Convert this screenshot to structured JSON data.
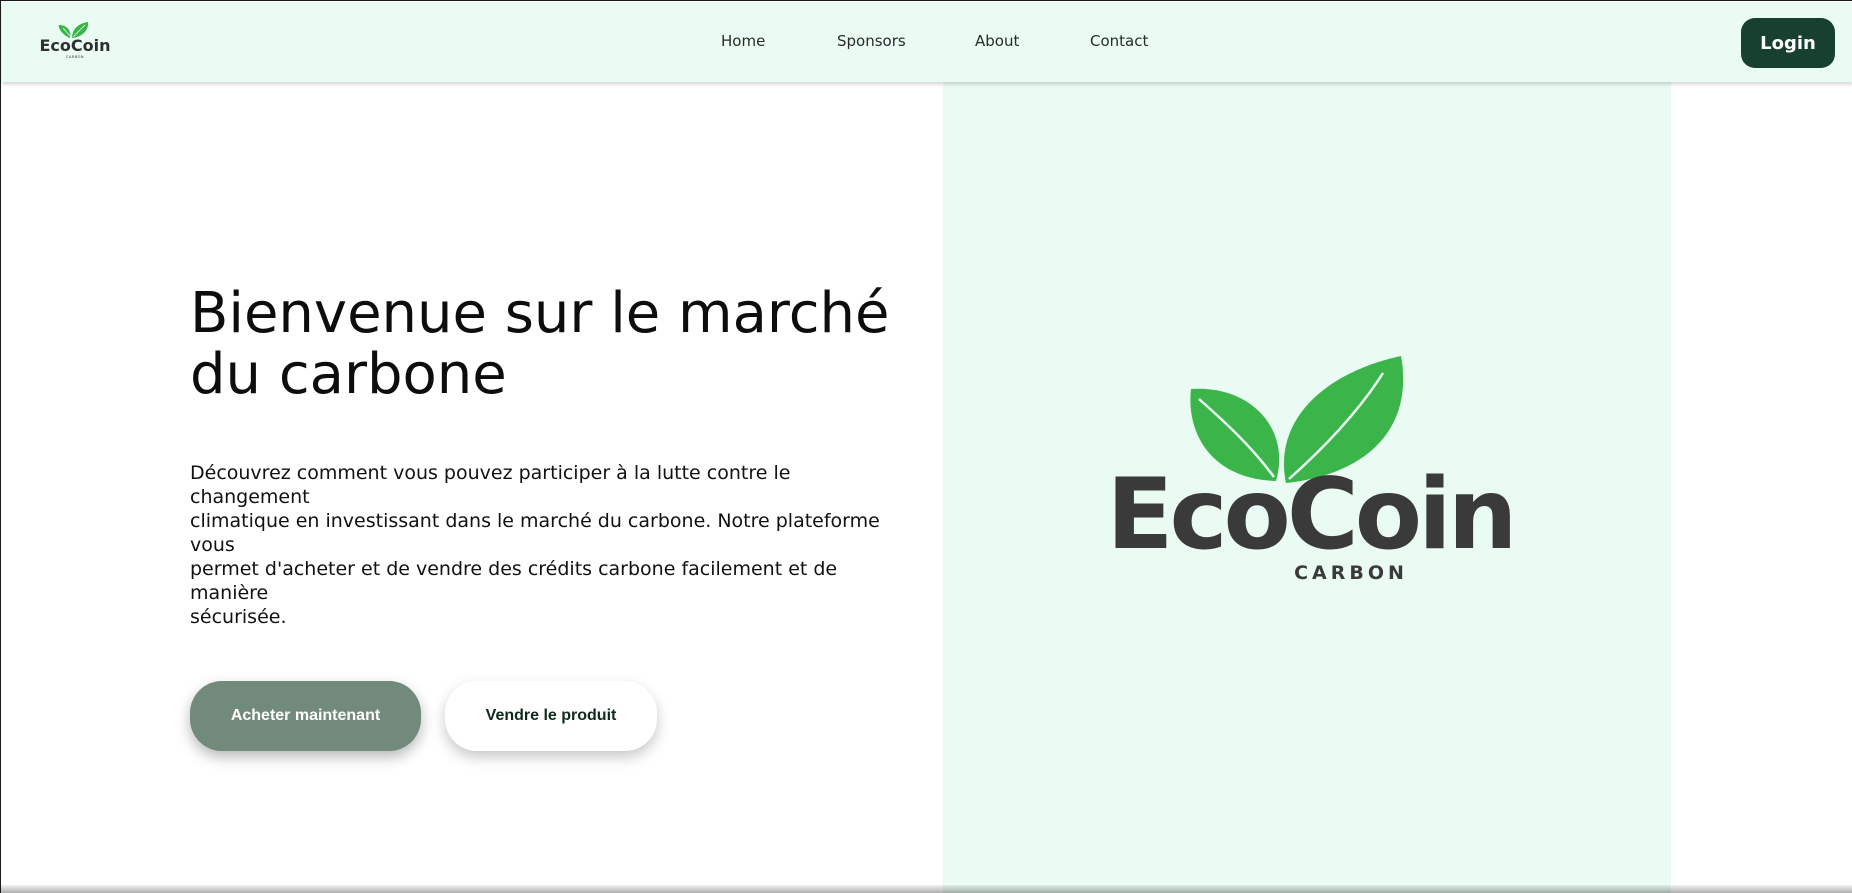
{
  "header": {
    "logo_text": "EcoCoin",
    "logo_subtext": "CARBON",
    "nav": [
      {
        "label": "Home"
      },
      {
        "label": "Sponsors"
      },
      {
        "label": "About"
      },
      {
        "label": "Contact"
      }
    ],
    "login_label": "Login"
  },
  "hero": {
    "title_line1": "Bienvenue sur le marché",
    "title_line2": "du carbone",
    "desc_line1": "Découvrez comment vous pouvez participer à la lutte contre le changement",
    "desc_line2": "climatique en investissant dans le marché du carbone. Notre plateforme vous",
    "desc_line3": "permet d'acheter et de vendre des crédits carbone facilement et de manière",
    "desc_line4": "sécurisée.",
    "buy_label": "Acheter maintenant",
    "sell_label": "Vendre le produit"
  },
  "brand": {
    "name": "EcoCoin",
    "sub": "CARBON"
  },
  "colors": {
    "header_bg": "#e9fbf2",
    "panel_bg": "#e9fbf2",
    "login_bg": "#17412e",
    "buy_bg": "#728a7b",
    "leaf_green": "#3bb54a",
    "logo_text": "#3a3a3a"
  },
  "icons": {
    "header_logo": "ecocoin-leaf-logo",
    "hero_logo": "ecocoin-leaf-logo"
  }
}
